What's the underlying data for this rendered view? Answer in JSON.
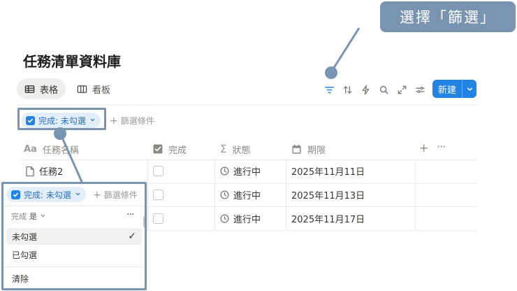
{
  "page": {
    "title": "任務清單資料庫"
  },
  "views": [
    {
      "label": "表格",
      "icon": "table-icon",
      "active": true
    },
    {
      "label": "看板",
      "icon": "board-icon",
      "active": false
    }
  ],
  "toolbar": {
    "icons": [
      "filter-icon",
      "sort-icon",
      "automation-icon",
      "search-icon",
      "expand-icon",
      "settings-icon"
    ],
    "new_label": "新建"
  },
  "filter_bar": {
    "chip_label": "完成: 未勾選",
    "add_filter_label": "篩選條件"
  },
  "table": {
    "columns": [
      {
        "label": "任務名稱",
        "icon": "Aa"
      },
      {
        "label": "完成",
        "icon": "checkbox-icon"
      },
      {
        "label": "狀態",
        "icon": "Σ"
      },
      {
        "label": "期限",
        "icon": "calendar-icon"
      }
    ],
    "rows": [
      {
        "name": "任務2",
        "done": false,
        "status": "進行中",
        "due": "2025年11月11日"
      },
      {
        "name": "",
        "done": false,
        "status": "進行中",
        "due": "2025年11月13日"
      },
      {
        "name": "",
        "done": false,
        "status": "進行中",
        "due": "2025年11月17日"
      }
    ]
  },
  "popup": {
    "chip_label": "完成: 未勾選",
    "add_filter_label": "篩選條件",
    "condition_label": "完成",
    "condition_op": "是",
    "options": [
      {
        "label": "未勾選",
        "selected": true
      },
      {
        "label": "已勾選",
        "selected": false
      }
    ],
    "clear_label": "清除"
  },
  "callout": {
    "text": "選擇「篩選」"
  },
  "colors": {
    "accent": "#2383e2",
    "annotation": "#7994b1"
  }
}
